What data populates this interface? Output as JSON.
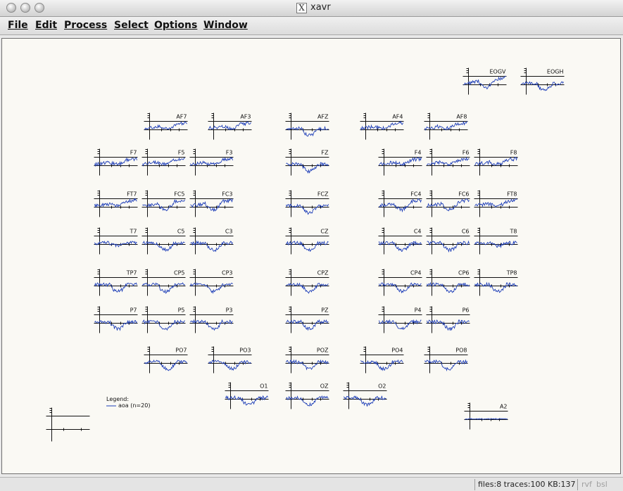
{
  "window": {
    "title": "xavr",
    "logo_glyph": "X"
  },
  "menu": [
    "File",
    "Edit",
    "Process",
    "Select",
    "Options",
    "Window"
  ],
  "legend": {
    "title": "Legend:",
    "entry": "aoa (n=20)",
    "color": "#1f3fb8"
  },
  "trace_color": "#1f3fb8",
  "axis_color": "#111111",
  "channels": [
    "EOGV",
    "EOGH",
    "AF7",
    "AF3",
    "AFZ",
    "AF4",
    "AF8",
    "F7",
    "F5",
    "F3",
    "FZ",
    "F4",
    "F6",
    "F8",
    "FT7",
    "FC5",
    "FC3",
    "FCZ",
    "FC4",
    "FC6",
    "FT8",
    "T7",
    "C5",
    "C3",
    "CZ",
    "C4",
    "C6",
    "T8",
    "TP7",
    "CP5",
    "CP3",
    "CPZ",
    "CP4",
    "CP6",
    "TP8",
    "P7",
    "P5",
    "P3",
    "PZ",
    "P4",
    "P6",
    "PO7",
    "PO3",
    "POZ",
    "PO4",
    "PO8",
    "O1",
    "OZ",
    "O2",
    "A2"
  ],
  "status": {
    "text": "files:8 traces:100 KB:137",
    "flag1": "rvf",
    "flag2": "bsl"
  }
}
